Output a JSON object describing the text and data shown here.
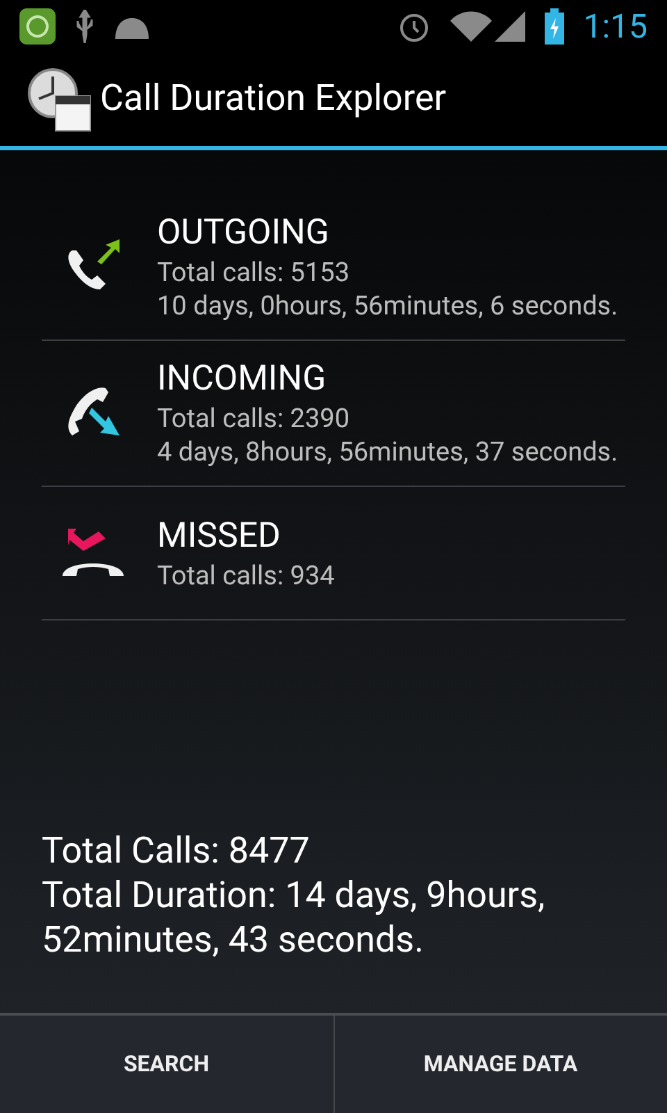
{
  "status_bar": {
    "time": "1:15"
  },
  "action_bar": {
    "title": "Call Duration Explorer"
  },
  "call_types": [
    {
      "kind": "outgoing",
      "title": "OUTGOING",
      "lines": [
        "Total calls: 5153",
        "10 days, 0hours, 56minutes, 6 seconds."
      ]
    },
    {
      "kind": "incoming",
      "title": "INCOMING",
      "lines": [
        "Total calls: 2390",
        "4 days, 8hours, 56minutes, 37 seconds."
      ]
    },
    {
      "kind": "missed",
      "title": "MISSED",
      "lines": [
        "Total calls: 934"
      ]
    }
  ],
  "summary": [
    "Total Calls: 8477",
    "Total Duration: 14 days, 9hours, 52minutes, 43 seconds."
  ],
  "buttons": [
    "SEARCH",
    "MANAGE DATA"
  ]
}
